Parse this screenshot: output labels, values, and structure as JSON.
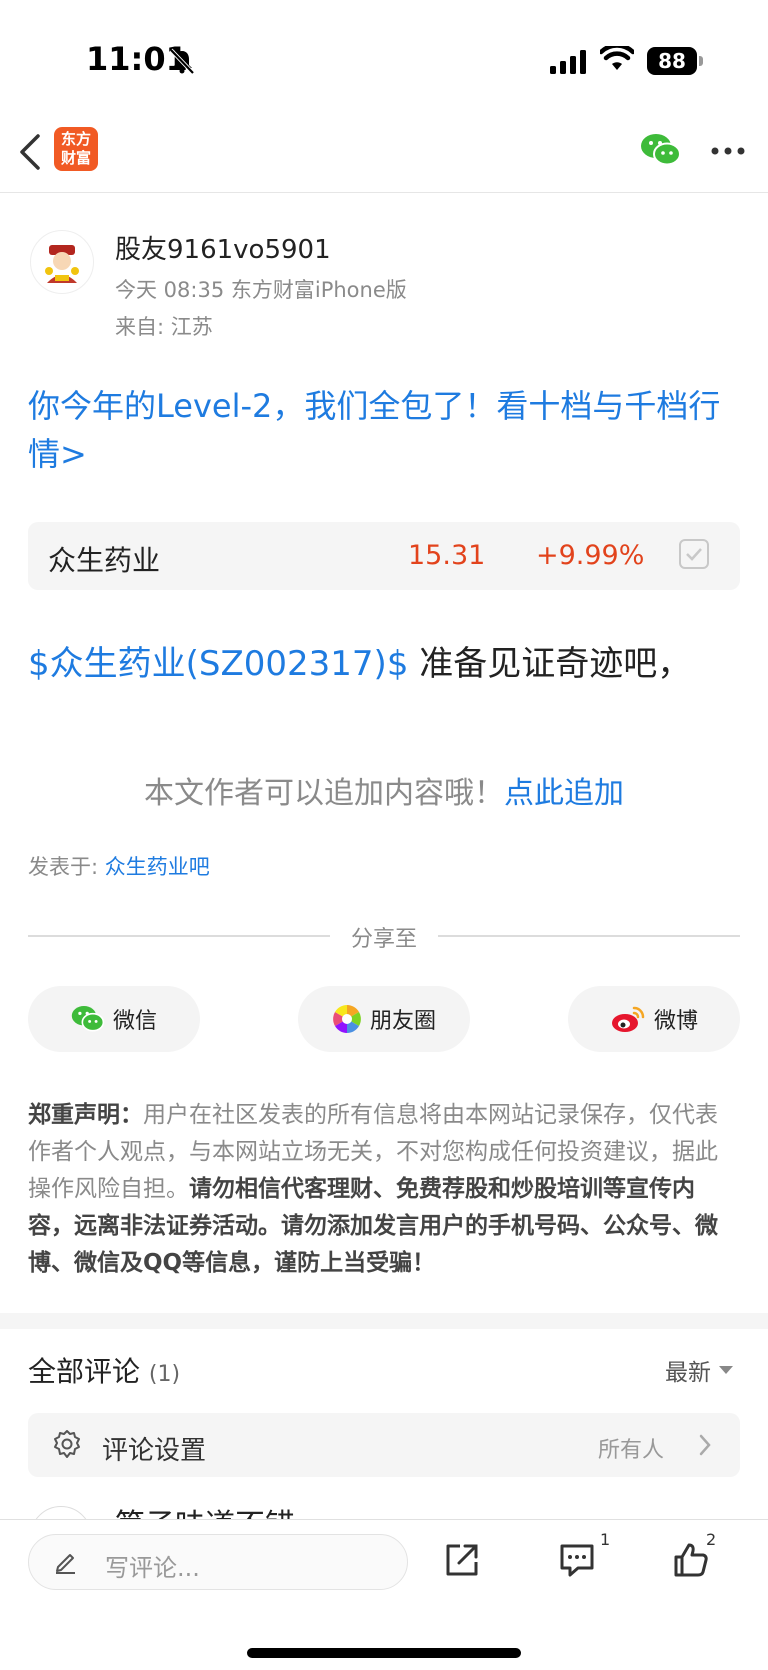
{
  "status_bar": {
    "time": "11:01",
    "battery": "88"
  },
  "nav": {
    "logo_text_line1": "东方",
    "logo_text_line2": "财富"
  },
  "author": {
    "name": "股友9161vo5901",
    "meta": "今天 08:35 东方财富iPhone版",
    "origin": "来自: 江苏"
  },
  "promo": {
    "text": "你今年的Level-2，我们全包了！看十档与千档行情>"
  },
  "stock": {
    "name": "众生药业",
    "price": "15.31",
    "change": "+9.99%"
  },
  "post": {
    "stock_tag": "$众生药业(SZ002317)$",
    "text": " 准备见证奇迹吧，"
  },
  "append": {
    "hint": "本文作者可以追加内容哦！",
    "link": "点此追加"
  },
  "posted_in": {
    "label": "发表于: ",
    "forum": "众生药业吧"
  },
  "share": {
    "title": "分享至",
    "wechat": "微信",
    "moments": "朋友圈",
    "weibo": "微博"
  },
  "disclaimer": {
    "label": "郑重声明：",
    "text": "用户在社区发表的所有信息将由本网站记录保存，仅代表作者个人观点，与本网站立场无关，不对您构成任何投资建议，据此操作风险自担。",
    "warning": "请勿相信代客理财、免费荐股和炒股培训等宣传内容，远离非法证券活动。请勿添加发言用户的手机号码、公众号、微博、微信及QQ等信息，谨防上当受骗！"
  },
  "comments": {
    "title": "全部评论",
    "count": "(1)",
    "sort": "最新",
    "settings_label": "评论设置",
    "settings_value": "所有人",
    "preview_text": "笋子味道不错"
  },
  "bottom_bar": {
    "placeholder": "写评论...",
    "comment_count": "1",
    "like_count": "2"
  },
  "colors": {
    "link": "#1e7be0",
    "rise": "#e2431c",
    "brand": "#f15a24"
  }
}
